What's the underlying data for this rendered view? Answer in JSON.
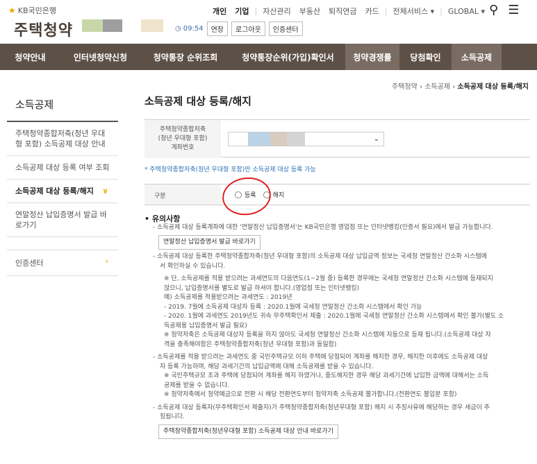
{
  "header": {
    "bank": "KB국민은행",
    "brand": "주택청약",
    "nav": [
      "개인",
      "기업",
      "자산관리",
      "부동산",
      "퇴직연금",
      "카드",
      "전체서비스 ▾",
      "GLOBAL ▾"
    ],
    "clock": "09:54",
    "buttons": [
      "연장",
      "로그아웃",
      "인증센터"
    ]
  },
  "gnb": [
    "청약안내",
    "인터넷청약신청",
    "청약통장 순위조회",
    "청약통장순위(가입)확인서",
    "청약경쟁률",
    "당첨확인",
    "소득공제"
  ],
  "breadcrumb": {
    "a": "주택청약",
    "b": "소득공제",
    "c": "소득공제 대상 등록/해지"
  },
  "side": {
    "title": "소득공제",
    "items": [
      "주택청약종합저축(청년 우대형 포함) 소득공제 대상 안내",
      "소득공제 대상 등록 여부 조회",
      "소득공제 대상 등록/해지",
      "연말정산 납입증명서 발급 바로가기"
    ],
    "cert": "인증센터"
  },
  "main": {
    "title": "소득공제 대상 등록/해지",
    "acc_label_1": "주택청약종합저축",
    "acc_label_2": "(청년 우대형 포함)",
    "acc_label_3": "계좌번호",
    "note_blue": "* 주택청약종합저축(청년 우대형 포함)만 소득공제 대상 등록 가능",
    "type_label": "구분",
    "radio_1": "등록",
    "radio_2": "해지",
    "notice_title": "유의사항",
    "n1": "- 소득공제 대상 등록계좌에 대한 '연말정산 납입증명서'는 KB국민은행 영업점 또는 인터넷뱅킹(인증서 필요)에서 발급 가능합니다.",
    "btn1": "연말정산 납입증명서 발급 바로가기",
    "n2a": "- 소득공제 대상 등록한 주택청약종합저축(청년 우대형 포함)의 소득공제 대상 납입금액 정보는 국세청 연말정산 간소화 시스템에",
    "n2b": "서 확인하실 수 있습니다.",
    "n2c": "※ 단, 소득공제를 적용 받으려는 과세연도의 다음연도(1~2월 중) 등록한 경우에는 국세청 연말정산 간소화 시스템에 등재되지",
    "n2d": "않으니, 납입증명서를 별도로 발급 하셔야 합니다.(영업점 또는 인터넷뱅킹)",
    "n2e": "예) 소득공제를 적용받으려는 과세연도 : 2019년",
    "n2f": "- 2019. 7월에 소득공제 대상자 등록 : 2020.1월에 국세청 연말정산 간소화 시스템에서 확인 가능",
    "n2g": "- 2020. 1월에 과세연도 2019년도 귀속 무주택확인서 제출 : 2020.1월에 국세청 연말정산 간소화 시스템에서 확인 불가(별도 소",
    "n2h": "득공제용 납입증명서 발급 필요)",
    "n2i": "※ 청약저축은 소득공제 대상자 등록을 하지 않아도 국세청 연말정산 간소화 시스템에 자동으로 등재 됩니다.(소득공제 대상 자",
    "n2j": "격을 충족해야함은 주택청약종합저축(청년 우대형 포함)과 동일함)",
    "n3a": "- 소득공제를 적용 받으려는 과세연도 중 국민주택규모 이하 주택에 당첨되어 계좌를 해지한 경우, 해지한 이후에도 소득공제 대상",
    "n3b": "자 등록 가능하며, 해당 과세기간의 납입금액에 대해 소득공제를 받을 수 있습니다.",
    "n3c": "※ 국민주택규모 초과 주택에 당첨되어 계좌를 해지 하였거나, 중도해지한 경우 해당 과세기간에 납입한 금액에 대해서는 소득",
    "n3d": "공제를 받을 수 없습니다.",
    "n3e": "※ 청약저축에서 청약예금으로 전환 시 해당 전환연도부터 청약저축 소득공제 불가합니다.(전환연도 불입분 포함)",
    "n4a": "- 소득공제 대상 등록자(무주택확인서 제출자)가 주택청약종합저축(청년우대형 포함) 해지 시 추징사유에 해당하는 경우 세금이 추",
    "n4b": "징됩니다.",
    "btn2": "주택청약종합저축(청년우대형 포함) 소득공제 대상 안내 바로가기"
  }
}
